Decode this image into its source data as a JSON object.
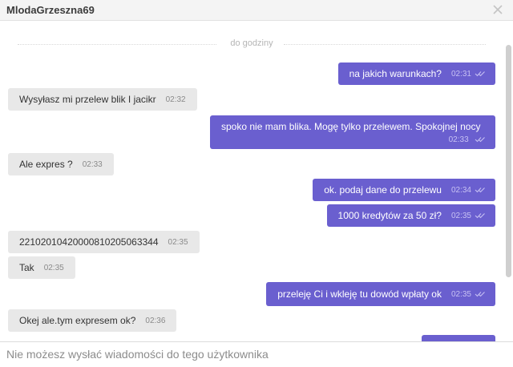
{
  "header": {
    "title": "MlodaGrzeszna69"
  },
  "divider": {
    "label": "do godziny"
  },
  "messages": [
    {
      "dir": "out",
      "text": "na jakich warunkach?",
      "time": "02:31"
    },
    {
      "dir": "in",
      "text": "Wysyłasz mi przelew blik I jacikr",
      "time": "02:32"
    },
    {
      "dir": "out",
      "text": "spoko nie mam blika. Mogę tylko przelewem. Spokojnej nocy",
      "time": "02:33"
    },
    {
      "dir": "in",
      "text": "Ale expres ?",
      "time": "02:33"
    },
    {
      "dir": "out",
      "text": "ok. podaj dane do przelewu",
      "time": "02:34"
    },
    {
      "dir": "out",
      "text": "1000 kredytów za 50 zł?",
      "time": "02:35"
    },
    {
      "dir": "in",
      "text": "22102010420000810205063344",
      "time": "02:35"
    },
    {
      "dir": "in",
      "text": "Tak",
      "time": "02:35"
    },
    {
      "dir": "out",
      "text": "przeleję Ci i wkleję tu dowód wpłaty ok",
      "time": "02:35"
    },
    {
      "dir": "in",
      "text": "Okej ale.tym expresem ok?",
      "time": "02:36"
    }
  ],
  "footer": {
    "placeholder": "Nie możesz wysłać wiadomości do tego użytkownika"
  }
}
